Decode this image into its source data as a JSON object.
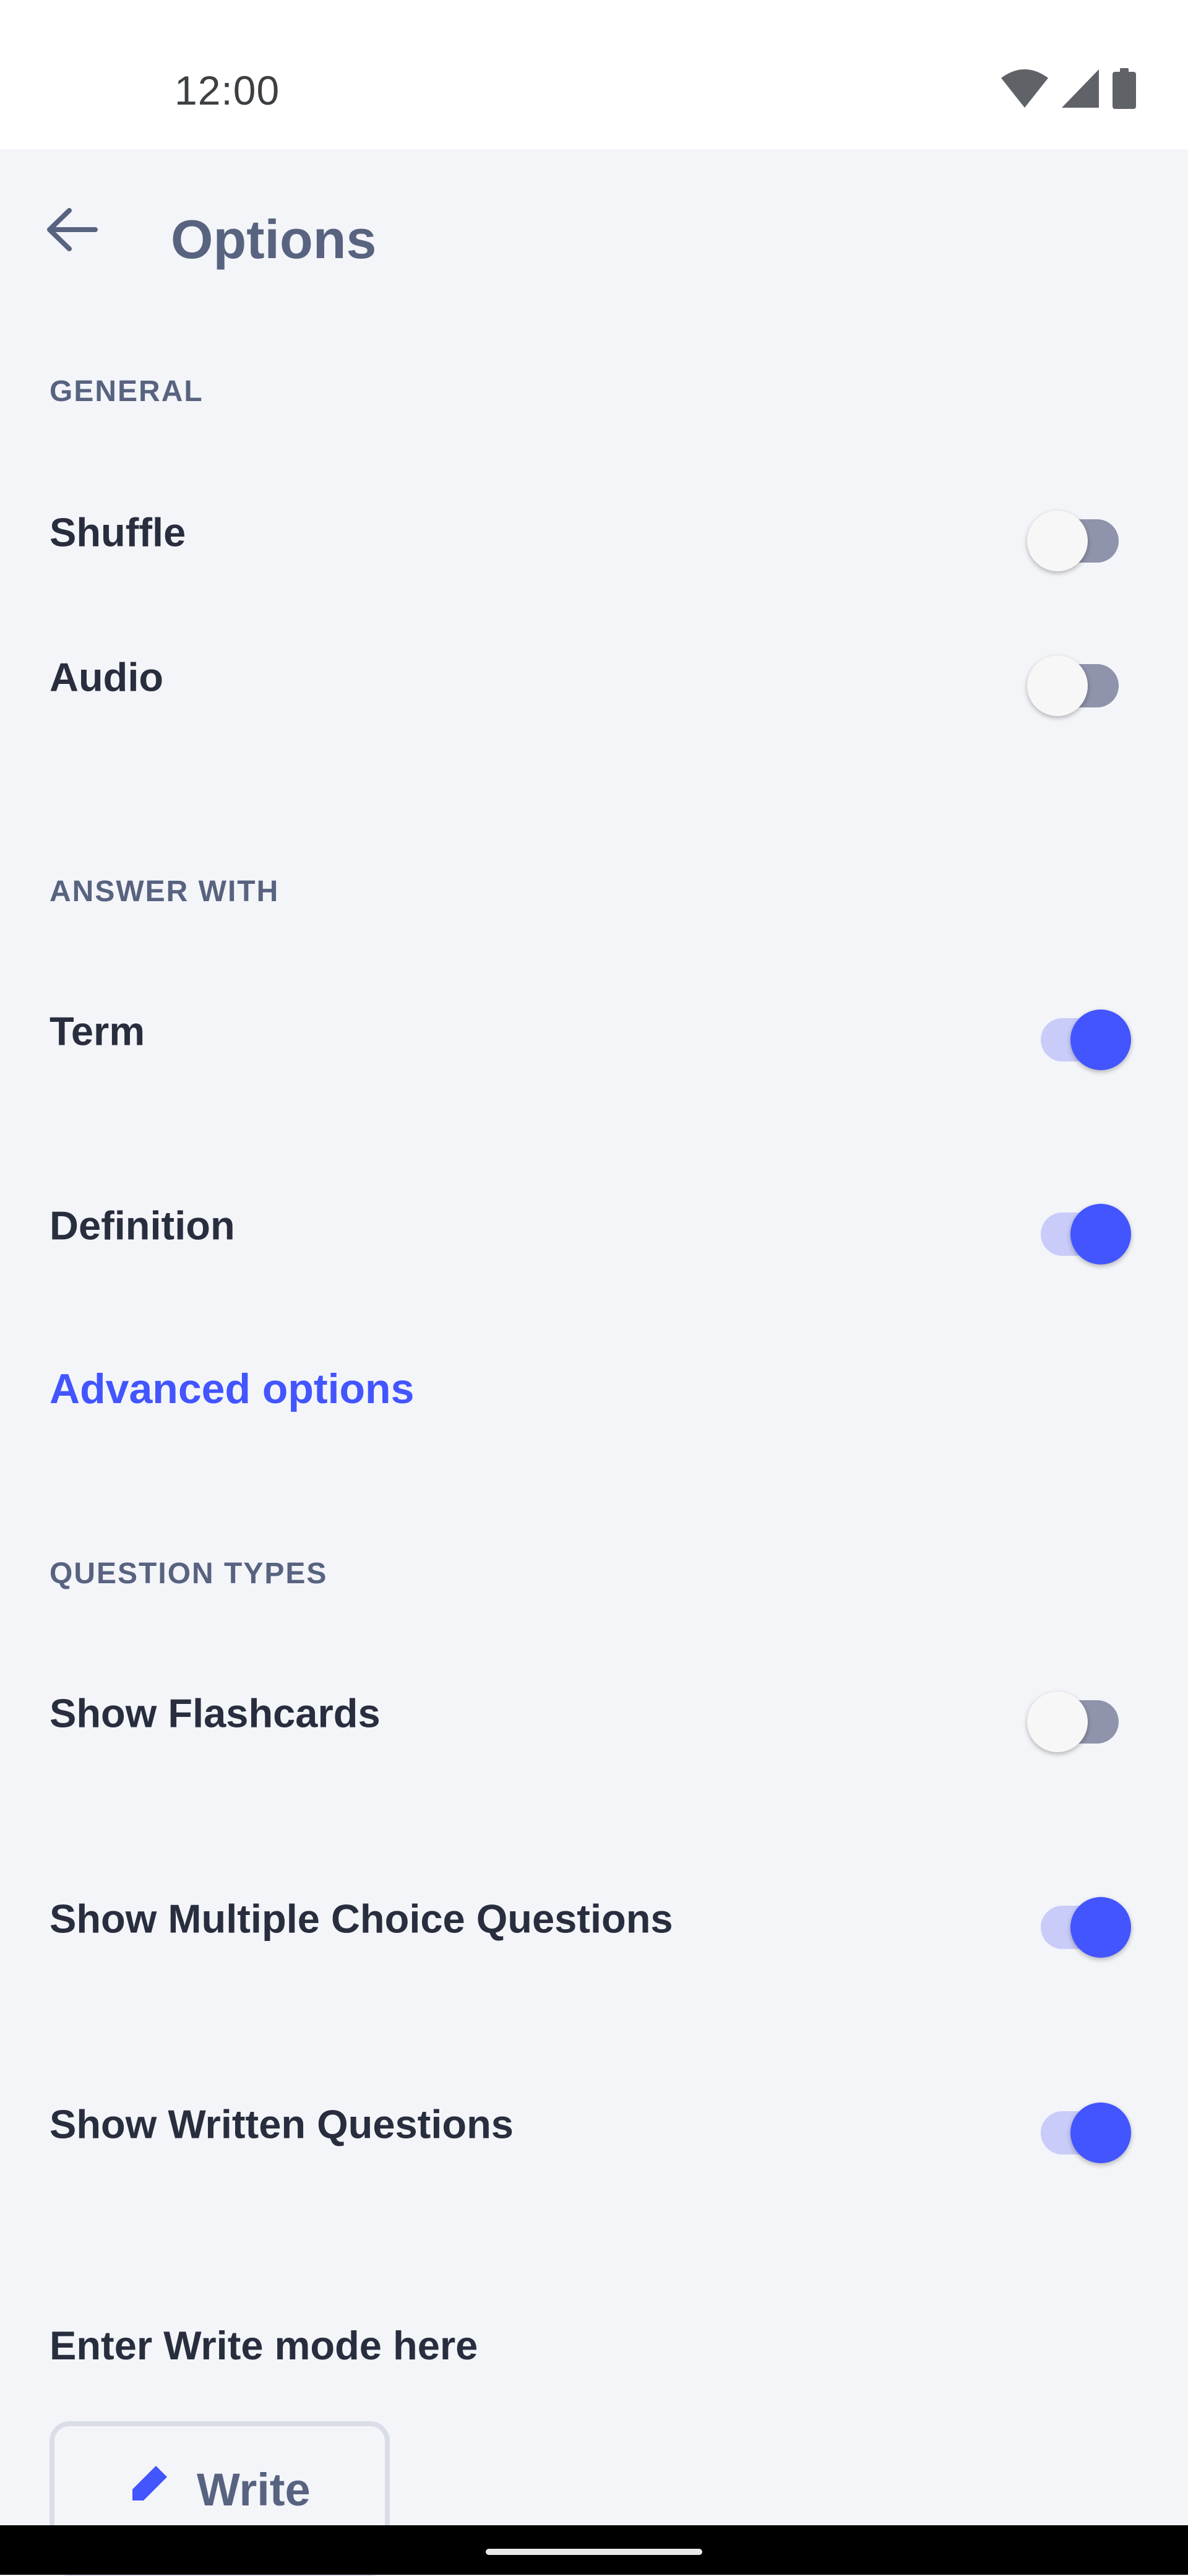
{
  "status_bar": {
    "time": "12:00",
    "icons": [
      "wifi-icon",
      "cellular-signal-icon",
      "battery-icon"
    ]
  },
  "app_bar": {
    "back_icon": "arrow-left-icon",
    "title": "Options"
  },
  "sections": {
    "general": {
      "header": "GENERAL",
      "items": [
        {
          "label": "Shuffle",
          "enabled": false
        },
        {
          "label": "Audio",
          "enabled": false
        }
      ]
    },
    "answer_with": {
      "header": "ANSWER WITH",
      "items": [
        {
          "label": "Term",
          "enabled": true
        },
        {
          "label": "Definition",
          "enabled": true
        }
      ],
      "advanced_link": "Advanced options"
    },
    "question_types": {
      "header": "QUESTION TYPES",
      "items": [
        {
          "label": "Show Flashcards",
          "enabled": false
        },
        {
          "label": "Show Multiple Choice Questions",
          "enabled": true
        },
        {
          "label": "Show Written Questions",
          "enabled": true
        }
      ]
    }
  },
  "write_mode": {
    "label": "Enter Write mode here",
    "button_label": "Write",
    "button_icon": "pen-icon"
  },
  "colors": {
    "accent": "#4255ff",
    "accent_track": "#c9ccf8",
    "off_track": "#8f93ab",
    "text_primary": "#282e3e",
    "text_secondary": "#586380",
    "background": "#f4f5f9"
  }
}
